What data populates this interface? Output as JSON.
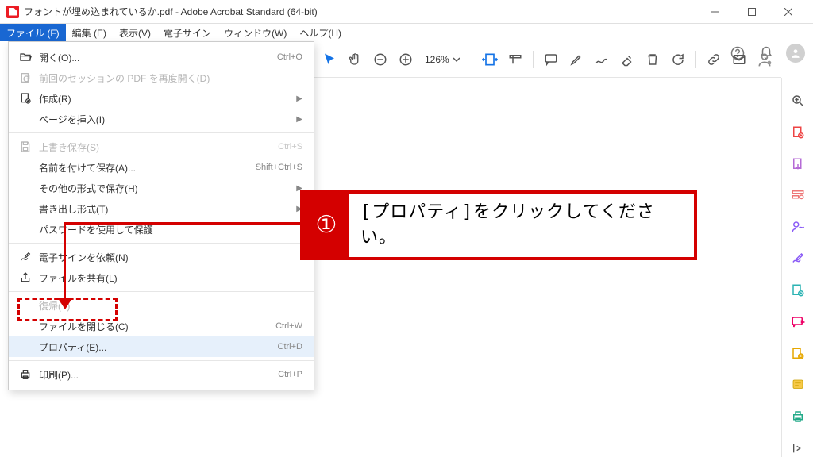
{
  "window": {
    "title": "フォントが埋め込まれているか.pdf - Adobe Acrobat Standard (64-bit)"
  },
  "menubar": [
    {
      "label": "ファイル (F)",
      "active": true
    },
    {
      "label": "編集 (E)"
    },
    {
      "label": "表示(V)"
    },
    {
      "label": "電子サイン"
    },
    {
      "label": "ウィンドウ(W)"
    },
    {
      "label": "ヘルプ(H)"
    }
  ],
  "dropdown": [
    {
      "type": "item",
      "label": "開く(O)...",
      "shortcut": "Ctrl+O",
      "icon": "folder-open"
    },
    {
      "type": "item",
      "label": "前回のセッションの PDF を再度開く(D)",
      "icon": "reopen",
      "disabled": true
    },
    {
      "type": "item",
      "label": "作成(R)",
      "icon": "create",
      "submenu": true
    },
    {
      "type": "item",
      "label": "ページを挿入(I)",
      "submenu": true
    },
    {
      "type": "sep"
    },
    {
      "type": "item",
      "label": "上書き保存(S)",
      "shortcut": "Ctrl+S",
      "icon": "save",
      "disabled": true
    },
    {
      "type": "item",
      "label": "名前を付けて保存(A)...",
      "shortcut": "Shift+Ctrl+S"
    },
    {
      "type": "item",
      "label": "その他の形式で保存(H)",
      "submenu": true
    },
    {
      "type": "item",
      "label": "書き出し形式(T)",
      "submenu": true
    },
    {
      "type": "item",
      "label": "パスワードを使用して保護"
    },
    {
      "type": "sep"
    },
    {
      "type": "item",
      "label": "電子サインを依頼(N)",
      "icon": "esign"
    },
    {
      "type": "item",
      "label": "ファイルを共有(L)",
      "icon": "share"
    },
    {
      "type": "sep"
    },
    {
      "type": "item",
      "label": "復帰(T)",
      "disabled": true
    },
    {
      "type": "item",
      "label": "ファイルを閉じる(C)",
      "shortcut": "Ctrl+W"
    },
    {
      "type": "item",
      "label": "プロパティ(E)...",
      "shortcut": "Ctrl+D",
      "hover": true
    },
    {
      "type": "sep"
    },
    {
      "type": "item",
      "label": "印刷(P)...",
      "shortcut": "Ctrl+P",
      "icon": "print"
    }
  ],
  "toolbar": {
    "zoom": "126%"
  },
  "callout": {
    "number": "①",
    "text": "[プロパティ]をクリックしてください。"
  }
}
